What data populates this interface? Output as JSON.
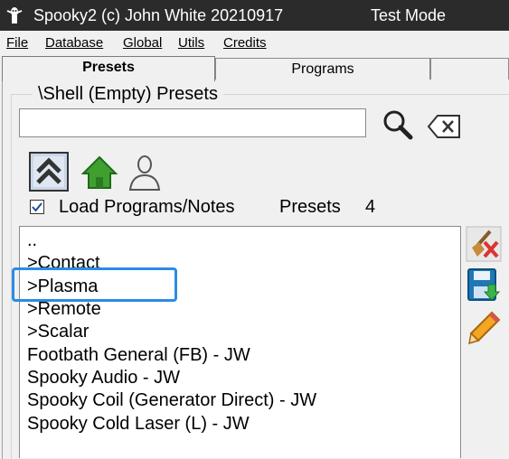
{
  "window": {
    "title": "Spooky2 (c) John White 20210917",
    "mode": "Test Mode"
  },
  "menu": [
    "File",
    "Database",
    "Global",
    "Utils",
    "Credits"
  ],
  "tabs": [
    {
      "label": "Presets",
      "active": true
    },
    {
      "label": "Programs",
      "active": false
    },
    {
      "label": "",
      "active": false
    }
  ],
  "presets": {
    "group_title": "\\Shell (Empty) Presets",
    "search": {
      "value": "",
      "placeholder": ""
    },
    "load_programs_label": "Load Programs/Notes",
    "load_programs_checked": true,
    "count_label": "Presets",
    "count": "4",
    "items": [
      "..",
      ">Contact",
      ">Plasma",
      ">Remote",
      ">Scalar",
      "Footbath General (FB) - JW",
      "Spooky Audio - JW",
      "Spooky Coil (Generator Direct) - JW",
      "Spooky Cold Laser (L) - JW"
    ],
    "highlighted_item": ">Plasma"
  },
  "colors": {
    "highlight": "#2a8ce6",
    "titlebar": "#2b2b2b",
    "home": "#3fa02f"
  },
  "icons": [
    "app-icon",
    "search-icon",
    "clear-icon",
    "up-level-icon",
    "home-icon",
    "user-icon",
    "erase-icon",
    "save-icon",
    "edit-icon"
  ]
}
